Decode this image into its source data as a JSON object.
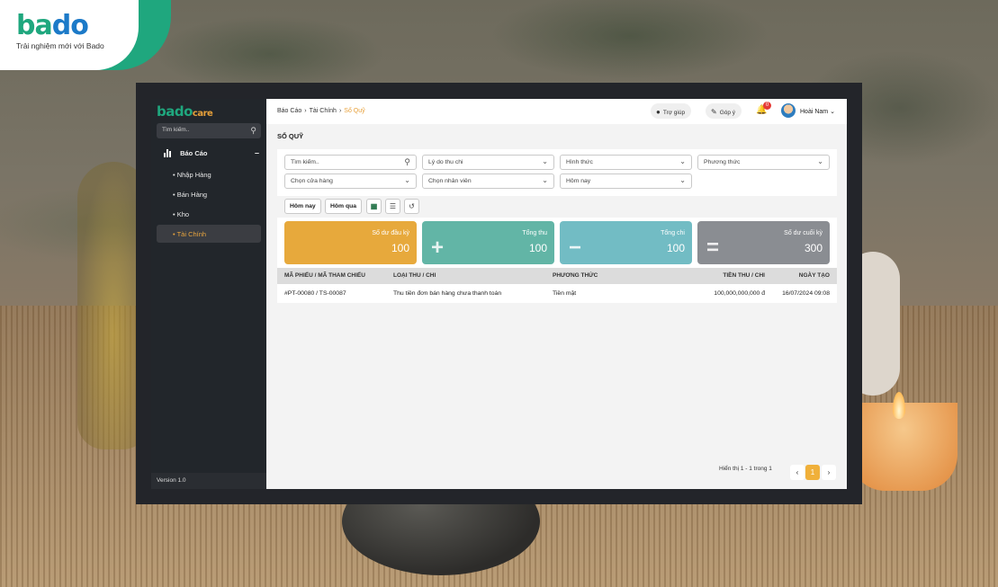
{
  "brand": {
    "logo_part1": "ba",
    "logo_part2": "do",
    "tagline": "Trải nghiệm mới với Bado"
  },
  "sidebar": {
    "logo_part1": "bado",
    "logo_part2": "care",
    "search_placeholder": "Tìm kiếm..",
    "group_label": "Báo Cáo",
    "items": [
      {
        "label": "Nhập Hàng"
      },
      {
        "label": "Bán Hàng"
      },
      {
        "label": "Kho"
      },
      {
        "label": "Tài Chính"
      }
    ],
    "version": "Version 1.0"
  },
  "topbar": {
    "breadcrumb": [
      "Báo Cáo",
      "Tài Chính",
      "Sổ Quỹ"
    ],
    "help_label": "Trợ giúp",
    "feedback_label": "Góp ý",
    "notification_count": "0",
    "user_name": "Hoài Nam"
  },
  "page": {
    "title": "SỔ QUỸ"
  },
  "filters": {
    "search_placeholder": "Tìm kiếm..",
    "reason": "Lý do thu chi",
    "form": "Hình thức",
    "method": "Phương thức",
    "store": "Chọn cửa hàng",
    "staff": "Chọn nhân viên",
    "date": "Hôm nay"
  },
  "quick": {
    "today": "Hôm nay",
    "yesterday": "Hôm qua"
  },
  "cards": [
    {
      "label": "Số dư đầu kỳ",
      "value": "100",
      "color": "#e7a93c",
      "symbol": ""
    },
    {
      "label": "Tổng thu",
      "value": "100",
      "color": "#62b5a6",
      "symbol": "+"
    },
    {
      "label": "Tổng chi",
      "value": "100",
      "color": "#72bcc4",
      "symbol": "−"
    },
    {
      "label": "Số dư cuối kỳ",
      "value": "300",
      "color": "#8a8d92",
      "symbol": "="
    }
  ],
  "table": {
    "headers": [
      "MÃ PHIẾU / MÃ THAM CHIẾU",
      "LOẠI THU / CHI",
      "PHƯƠNG THỨC",
      "TIỀN THU / CHI",
      "NGÀY TẠO"
    ],
    "rows": [
      [
        "#PT-00080 / TS-00087",
        "Thu tiền đơn bán hàng chưa thanh toán",
        "Tiền mặt",
        "100,000,000,000 đ",
        "16/07/2024 09:08"
      ]
    ]
  },
  "pagination": {
    "summary": "Hiển thị 1 - 1 trong 1",
    "current_page": "1",
    "accent": "#f0b03a"
  }
}
